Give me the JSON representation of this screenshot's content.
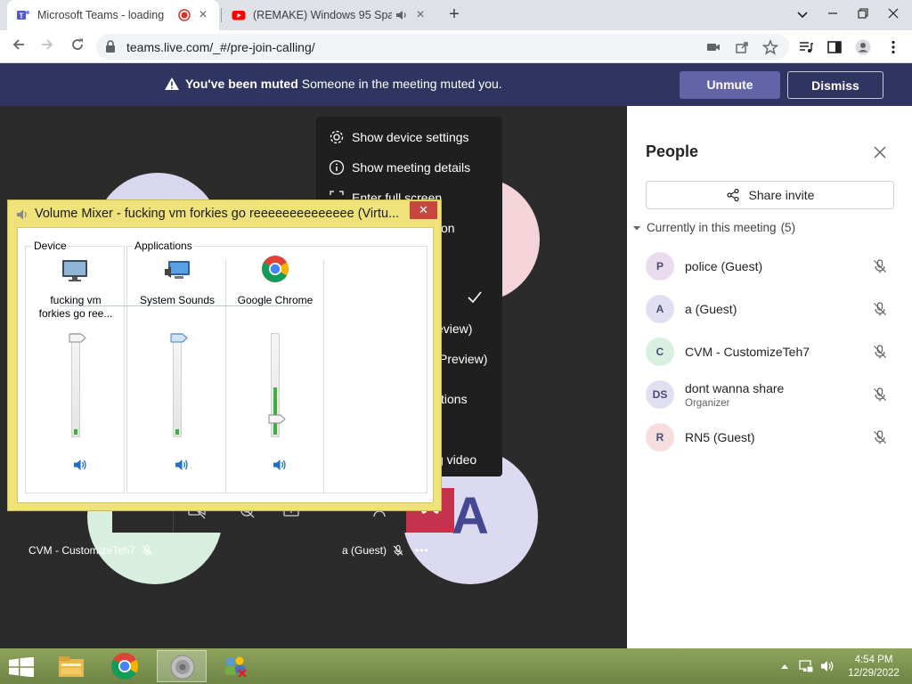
{
  "browser": {
    "tabs": [
      {
        "title": "Microsoft Teams - loading",
        "active": true,
        "recording": true
      },
      {
        "title": "(REMAKE) Windows 95 Spar",
        "active": false,
        "audio": true
      }
    ],
    "url": "teams.live.com/_#/pre-join-calling/",
    "icons": [
      "back-icon",
      "forward-icon",
      "reload-icon",
      "lock-icon",
      "camera-icon",
      "share-icon",
      "star-icon",
      "media-icon",
      "side-panel-icon",
      "profile-icon",
      "menu-icon"
    ]
  },
  "banner": {
    "bold": "You've been muted",
    "text": "Someone in the meeting muted you.",
    "unmute": "Unmute",
    "dismiss": "Dismiss"
  },
  "menu": {
    "items": [
      "Show device settings",
      "Show meeting details",
      "Enter full screen",
      "on",
      "eview)",
      "Preview)",
      "tions",
      "g video"
    ]
  },
  "stage": {
    "tile_a_name": "CVM - CustomizeTeh7",
    "tile_b_name": "a (Guest)",
    "tile_b_initial": "A"
  },
  "people": {
    "title": "People",
    "share": "Share invite",
    "section": "Currently in this meeting",
    "count": "(5)",
    "members": [
      {
        "initials": "P",
        "name": "police (Guest)",
        "role": "",
        "color": "#eadcee"
      },
      {
        "initials": "A",
        "name": "a (Guest)",
        "role": "",
        "color": "#e1dff2"
      },
      {
        "initials": "C",
        "name": "CVM - CustomizeTeh7",
        "role": "",
        "color": "#d9efe0"
      },
      {
        "initials": "DS",
        "name": "dont wanna share",
        "role": "Organizer",
        "color": "#e1dff2"
      },
      {
        "initials": "R",
        "name": "RN5 (Guest)",
        "role": "",
        "color": "#f6dede"
      }
    ]
  },
  "mixer": {
    "title": "Volume Mixer - fucking vm forkies go reeeeeeeeeeeeee (Virtu...",
    "device_label": "Device",
    "apps_label": "Applications",
    "channels": [
      {
        "name_line1": "fucking vm",
        "name_line2": "forkies go ree...",
        "level": 0.05,
        "volume": 1.0
      },
      {
        "name_line1": "System Sounds",
        "name_line2": "",
        "level": 0.05,
        "volume": 1.0
      },
      {
        "name_line1": "Google Chrome",
        "name_line2": "",
        "level": 0.48,
        "volume": 0.14
      }
    ]
  },
  "taskbar": {
    "time": "4:54 PM",
    "date": "12/29/2022"
  }
}
